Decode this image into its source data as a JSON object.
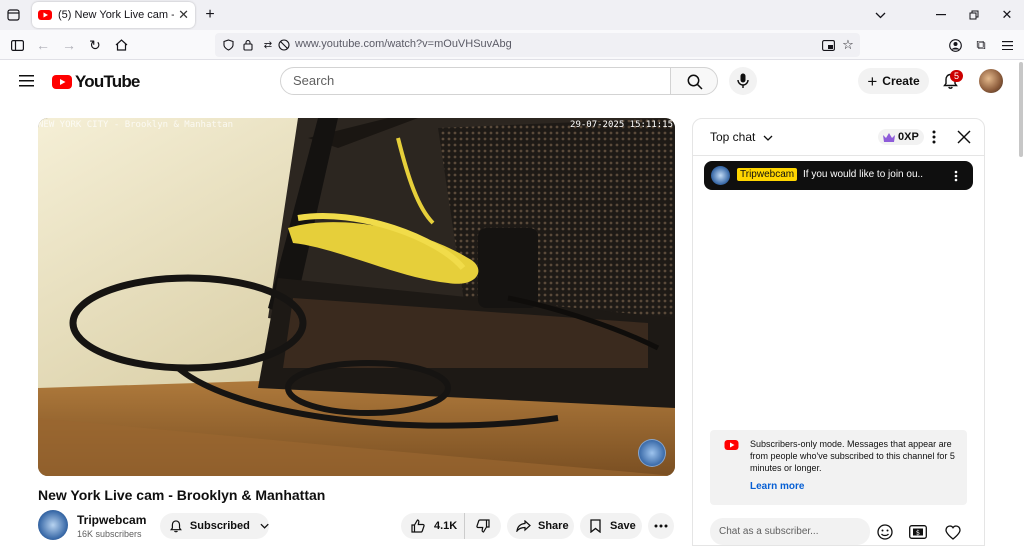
{
  "browser": {
    "tab_title": "(5) New York Live cam - Brooklyn & Manhattan",
    "url": "www.youtube.com/watch?v=mOuVHSuvAbg"
  },
  "youtube": {
    "logo_text": "YouTube",
    "search_placeholder": "Search",
    "create_label": "Create",
    "notification_count": "5",
    "brand_color": "#ff0000"
  },
  "video": {
    "overlay_left": "NEW YORK CITY - Brooklyn & Manhattan",
    "overlay_timestamp": "29-07-2025 15:11:15",
    "title": "New York Live cam - Brooklyn & Manhattan"
  },
  "channel": {
    "name": "Tripwebcam",
    "subscribers": "16K subscribers",
    "subscribed_label": "Subscribed"
  },
  "actions": {
    "likes": "4.1K",
    "share_label": "Share",
    "save_label": "Save"
  },
  "chat": {
    "mode_label": "Top chat",
    "xp": "0XP",
    "pinned": {
      "author": "Tripwebcam",
      "message": "If you would like to join ou..."
    },
    "notice": "Subscribers-only mode. Messages that appear are from people who've subscribed to this channel for 5 minutes or longer.",
    "learn_more": "Learn more",
    "input_placeholder": "Chat as a subscriber..."
  }
}
